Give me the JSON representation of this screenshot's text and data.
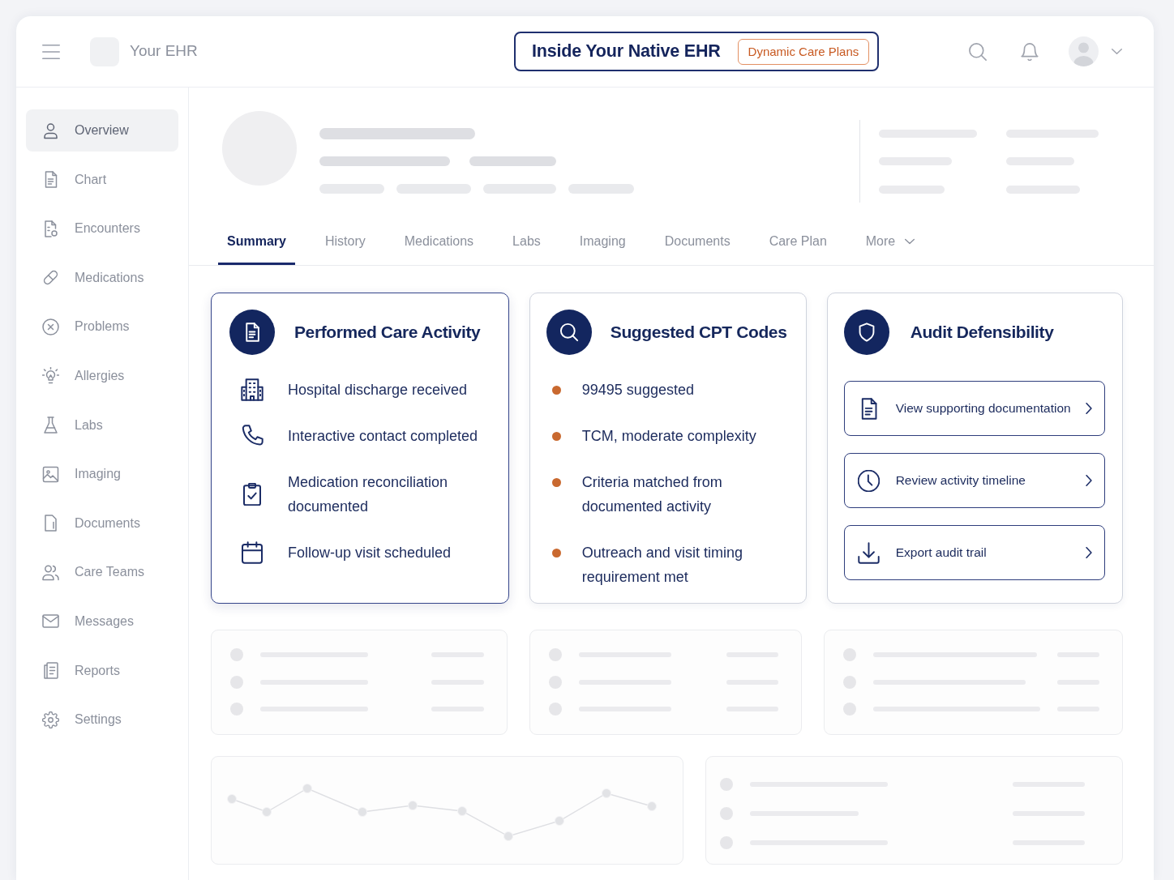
{
  "header": {
    "brand": "Your EHR",
    "banner": {
      "title": "Inside Your Native EHR",
      "badge": "Dynamic Care Plans"
    }
  },
  "sidebar": {
    "items": [
      {
        "label": "Overview",
        "selected": true
      },
      {
        "label": "Chart",
        "selected": false
      },
      {
        "label": "Encounters",
        "selected": false
      },
      {
        "label": "Medications",
        "selected": false
      },
      {
        "label": "Problems",
        "selected": false
      },
      {
        "label": "Allergies",
        "selected": false
      },
      {
        "label": "Labs",
        "selected": false
      },
      {
        "label": "Imaging",
        "selected": false
      },
      {
        "label": "Documents",
        "selected": false
      },
      {
        "label": "Care Teams",
        "selected": false
      },
      {
        "label": "Messages",
        "selected": false
      },
      {
        "label": "Reports",
        "selected": false
      },
      {
        "label": "Settings",
        "selected": false
      }
    ]
  },
  "tabs": [
    {
      "label": "Summary",
      "selected": true,
      "kind": "tab"
    },
    {
      "label": "History",
      "selected": false,
      "kind": "tab"
    },
    {
      "label": "Medications",
      "selected": false,
      "kind": "tab"
    },
    {
      "label": "Labs",
      "selected": false,
      "kind": "tab"
    },
    {
      "label": "Imaging",
      "selected": false,
      "kind": "tab"
    },
    {
      "label": "Documents",
      "selected": false,
      "kind": "tab"
    },
    {
      "label": "Care Plan",
      "selected": false,
      "kind": "tab"
    },
    {
      "label": "More",
      "selected": false,
      "kind": "dropdown"
    }
  ],
  "cards": [
    {
      "kind": "activity",
      "title": "Performed Care Activity",
      "highlighted": true,
      "items": [
        "Hospital discharge received",
        "Interactive contact completed",
        "Medication reconciliation documented",
        "Follow-up visit scheduled"
      ]
    },
    {
      "kind": "bullets",
      "title": "Suggested CPT Codes",
      "highlighted": false,
      "items": [
        "99495 suggested",
        "TCM, moderate complexity",
        "Criteria matched from documented activity",
        "Outreach and visit timing requirement met"
      ]
    },
    {
      "kind": "links",
      "title": "Audit Defensibility",
      "highlighted": false,
      "items": [
        "View supporting documentation",
        "Review activity timeline",
        "Export audit trail"
      ]
    }
  ]
}
